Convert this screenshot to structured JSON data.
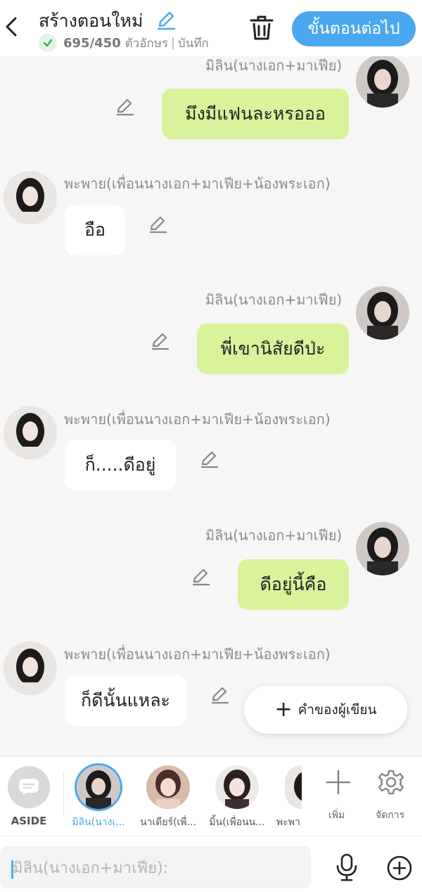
{
  "header": {
    "title": "สร้างตอนใหม่",
    "char_count": "695/450",
    "char_unit": "ตัวอักษร",
    "separator": "|",
    "save_label": "บันทึก",
    "next_button": "ขั้นตอนต่อไป",
    "icons": [
      "back-icon",
      "edit-title-icon",
      "check-icon",
      "trash-icon"
    ]
  },
  "colors": {
    "accent": "#4aa8ee",
    "bubble_right": "#d8f39a",
    "bubble_left": "#ffffff",
    "background": "#f6f6f6"
  },
  "messages": [
    {
      "side": "right",
      "name": "มิลิน(นางเอก+มาเฟีย)",
      "text": "มึงมีแฟนละหรอออ"
    },
    {
      "side": "left",
      "name": "พะพาย(เพื่อนนางเอก+มาเฟีย+น้องพระเอก)",
      "text": "อือ"
    },
    {
      "side": "right",
      "name": "มิลิน(นางเอก+มาเฟีย)",
      "text": "พี่เขานิสัยดีป่ะ"
    },
    {
      "side": "left",
      "name": "พะพาย(เพื่อนนางเอก+มาเฟีย+น้องพระเอก)",
      "text": "ก็.....ดีอยู่"
    },
    {
      "side": "right",
      "name": "มิลิน(นางเอก+มาเฟีย)",
      "text": "ดีอยู่นี้คือ"
    },
    {
      "side": "left",
      "name": "พะพาย(เพื่อนนางเอก+มาเฟีย+น้องพระเอก)",
      "text": "ก็ดีนั้นแหละ"
    }
  ],
  "fab": {
    "label": "คำของผู้เขียน"
  },
  "character_bar": {
    "aside_label": "ASIDE",
    "characters": [
      {
        "label": "มิลิน(นางเ...",
        "selected": true
      },
      {
        "label": "นาเดียร์(เพื่...",
        "selected": false
      },
      {
        "label": "มิ้น(เพื่อนน...",
        "selected": false
      },
      {
        "label": "พะพา",
        "selected": false
      }
    ],
    "add_label": "เพิ่ม",
    "manage_label": "จัดการ"
  },
  "composer": {
    "placeholder": "มิลิน(นางเอก+มาเฟีย):"
  }
}
